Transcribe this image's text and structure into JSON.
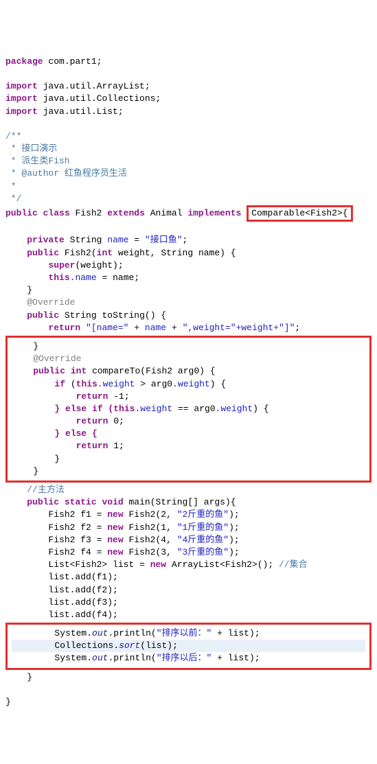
{
  "pkg": {
    "kw": "package",
    "name": "com.part1"
  },
  "imports": [
    {
      "kw": "import",
      "name": "java.util.ArrayList"
    },
    {
      "kw": "import",
      "name": "java.util.Collections"
    },
    {
      "kw": "import",
      "name": "java.util.List"
    }
  ],
  "javadoc": {
    "open": "/**",
    "l1": " * 接口演示",
    "l2": " * 派生类Fish",
    "authorTag": " * @author ",
    "authorName": "红鱼程序员生活",
    "l3": " *",
    "close": " */"
  },
  "cls": {
    "pub": "public",
    "class_kw": "class",
    "name": "Fish2",
    "extends_kw": "extends",
    "parent": "Animal",
    "impl_kw": "implements",
    "iface": "Comparable<Fish2>{"
  },
  "field": {
    "priv": "private",
    "type": "String",
    "name": "name",
    "eq": "=",
    "val": "\"接口鱼\""
  },
  "ctor": {
    "pub": "public",
    "name": "Fish2",
    "int_kw": "int",
    "p1": "weight",
    "str_t": "String",
    "p2": "name",
    "open": ") {",
    "super_kw": "super",
    "sup_arg": "(weight);",
    "this_kw": "this",
    "dot_name": ".name",
    "eq": "=",
    "rhs": "name;"
  },
  "tostr": {
    "ann": "@Override",
    "pub": "public",
    "type": "String",
    "name": "toString",
    "open": "() {",
    "ret": "return",
    "s1": "\"[name=\"",
    "plus1": "+",
    "nameRef": "name",
    "plus2": "+",
    "s2": "\",weight=\"",
    "sWeightRef": "+weight+",
    "s3": "\"]\""
  },
  "cmp": {
    "ann": "@Override",
    "pub": "public",
    "int_kw": "int",
    "name": "compareTo",
    "argT": "Fish2",
    "argN": "arg0",
    "open": ") {",
    "if_kw": "if",
    "this_kw": "this",
    "dotW": ".weight",
    "gt": ">",
    "arg": "arg0",
    "dotW2": ".weight",
    "open2": ") {",
    "ret": "return",
    "m1": "-1;",
    "else_if": "} else if (",
    "eq": "==",
    "open3": ") {",
    "r0": "0;",
    "else_kw": "} else {",
    "r1": "1;"
  },
  "mainComment": "//主方法",
  "main": {
    "pub": "public",
    "static_kw": "static",
    "void_kw": "void",
    "name": "main",
    "argT": "String[]",
    "argN": "args",
    "open": "){",
    "v1": "f1",
    "v2": "f2",
    "v3": "f3",
    "v4": "f4",
    "new_kw": "new",
    "cls": "Fish2",
    "a1": "2",
    "s1": "\"2斤重的鱼\"",
    "a2": "1",
    "s2": "\"1斤重的鱼\"",
    "a3": "4",
    "s3": "\"4斤重的鱼\"",
    "a4": "3",
    "s4": "\"3斤重的鱼\"",
    "listT": "List<Fish2>",
    "listN": "list",
    "arrT": "ArrayList<Fish2>",
    "arrOpen": "();",
    "cmt": "//集合",
    "add": "add",
    "sys": "System",
    "out": "out",
    "println": "println",
    "before": "\"排序以前：\"",
    "plus": "+",
    "listRef": "list",
    "coll": "Collections",
    "sort": "sort",
    "after": "\"排序以后：\""
  }
}
